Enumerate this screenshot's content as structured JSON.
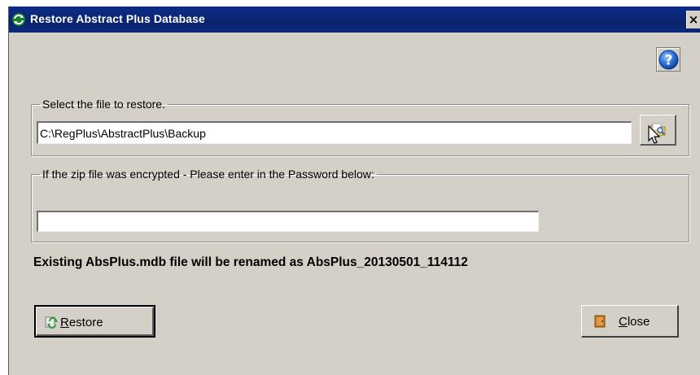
{
  "window": {
    "title": "Restore Abstract Plus Database",
    "close_glyph": "×"
  },
  "file_group": {
    "legend": "Select the file to restore.",
    "path_value": "C:\\RegPlus\\AbstractPlus\\Backup"
  },
  "password_group": {
    "legend": "If the zip file was encrypted - Please enter in the Password below:",
    "password_value": ""
  },
  "rename_message": "Existing AbsPlus.mdb file will be renamed as AbsPlus_20130501_114112",
  "buttons": {
    "restore": {
      "mnemonic": "R",
      "rest": "estore"
    },
    "close": {
      "mnemonic": "C",
      "rest": "lose"
    }
  },
  "icons": {
    "app": "refresh-arrows-icon",
    "help": "question-mark-icon",
    "browse": "folder-search-icon",
    "restore": "restore-icon",
    "close": "door-icon"
  },
  "colors": {
    "titlebar": "#0a246a",
    "dialog_bg": "#d4d0c8",
    "help_blue": "#2a6fd6"
  }
}
